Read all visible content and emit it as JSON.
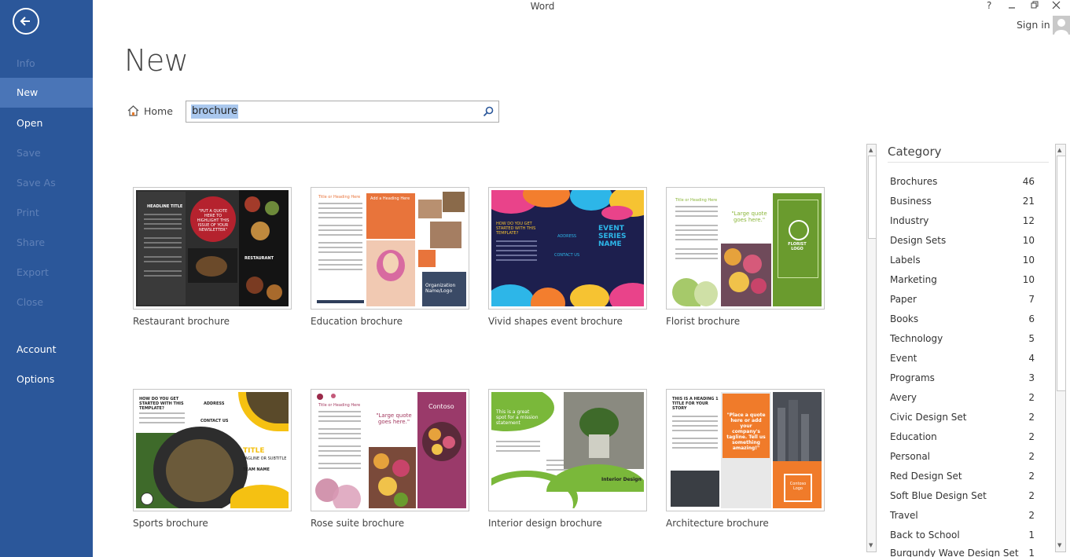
{
  "app": {
    "title": "Word",
    "help": "?",
    "sign_in": "Sign in"
  },
  "sidebar": {
    "items": [
      {
        "label": "Info",
        "state": "disabled"
      },
      {
        "label": "New",
        "state": "active"
      },
      {
        "label": "Open",
        "state": "normal"
      },
      {
        "label": "Save",
        "state": "disabled"
      },
      {
        "label": "Save As",
        "state": "disabled"
      },
      {
        "label": "Print",
        "state": "disabled"
      },
      {
        "label": "Share",
        "state": "disabled"
      },
      {
        "label": "Export",
        "state": "disabled"
      },
      {
        "label": "Close",
        "state": "disabled"
      },
      {
        "label": "Account",
        "state": "normal"
      },
      {
        "label": "Options",
        "state": "normal"
      }
    ],
    "bg_color": "#2b579a",
    "active_color": "#4a75b7"
  },
  "main": {
    "title": "New",
    "home_label": "Home",
    "search": {
      "value": "brochure"
    }
  },
  "templates": [
    {
      "label": "Restaurant brochure"
    },
    {
      "label": "Education brochure"
    },
    {
      "label": "Vivid shapes event brochure"
    },
    {
      "label": "Florist brochure"
    },
    {
      "label": "Sports brochure"
    },
    {
      "label": "Rose suite brochure"
    },
    {
      "label": "Interior design brochure"
    },
    {
      "label": "Architecture brochure"
    }
  ],
  "thumb_text": {
    "restaurant": {
      "headline": "HEADLINE TITLE",
      "quote": "\"PUT A QUOTE HERE TO HIGHLIGHT THIS ISSUE OF YOUR NEWSLETTER\"",
      "logo": "RESTAURANT"
    },
    "education": {
      "heading": "Title or Heading Here",
      "heading2": "Add a Heading Here",
      "org": "Organization Name/Logo"
    },
    "vivid": {
      "question": "HOW DO YOU GET STARTED WITH THIS TEMPLATE?",
      "address": "ADDRESS",
      "contact": "CONTACT US",
      "event": "EVENT SERIES NAME"
    },
    "florist": {
      "heading": "Title or Heading Here",
      "quote": "\"Large quote goes here.\"",
      "logo": "FLORIST LOGO"
    },
    "sports": {
      "question": "HOW DO YOU GET STARTED WITH THIS TEMPLATE?",
      "address": "ADDRESS",
      "contact": "CONTACT US",
      "title": "TITLE",
      "tagline": "TAGLINE OR SUBTITLE",
      "team": "TEAM NAME"
    },
    "rose": {
      "heading": "Title or Heading Here",
      "quote": "\"Large quote goes here.\"",
      "logo": "Contoso"
    },
    "interior": {
      "quote": "This is a great spot for a mission statement",
      "title": "Interior Design"
    },
    "architecture": {
      "heading": "THIS IS A HEADING 1 TITLE FOR YOUR STORY",
      "quote": "\"Place a quote here or add your company's tagline. Tell us something amazing!\"",
      "logo": "Contoso Logo"
    }
  },
  "category": {
    "title": "Category",
    "items": [
      {
        "name": "Brochures",
        "count": "46"
      },
      {
        "name": "Business",
        "count": "21"
      },
      {
        "name": "Industry",
        "count": "12"
      },
      {
        "name": "Design Sets",
        "count": "10"
      },
      {
        "name": "Labels",
        "count": "10"
      },
      {
        "name": "Marketing",
        "count": "10"
      },
      {
        "name": "Paper",
        "count": "7"
      },
      {
        "name": "Books",
        "count": "6"
      },
      {
        "name": "Technology",
        "count": "5"
      },
      {
        "name": "Event",
        "count": "4"
      },
      {
        "name": "Programs",
        "count": "3"
      },
      {
        "name": "Avery",
        "count": "2"
      },
      {
        "name": "Civic Design Set",
        "count": "2"
      },
      {
        "name": "Education",
        "count": "2"
      },
      {
        "name": "Personal",
        "count": "2"
      },
      {
        "name": "Red Design Set",
        "count": "2"
      },
      {
        "name": "Soft Blue Design Set",
        "count": "2"
      },
      {
        "name": "Travel",
        "count": "2"
      },
      {
        "name": "Back to School",
        "count": "1"
      },
      {
        "name": "Burgundy Wave Design Set",
        "count": "1"
      }
    ]
  }
}
